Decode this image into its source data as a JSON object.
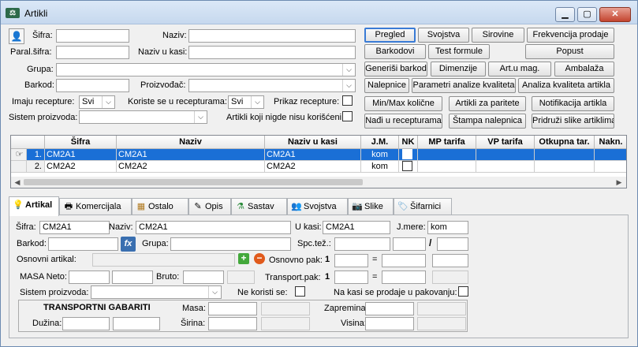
{
  "window": {
    "title": "Artikli",
    "app_icon": "scale-icon"
  },
  "filters": {
    "sifra_label": "Šifra:",
    "sifra_value": "",
    "naziv_label": "Naziv:",
    "naziv_value": "",
    "paral_sifra_label": "Paral.šifra:",
    "paral_sifra_value": "",
    "naziv_u_kasi_label": "Naziv u kasi:",
    "naziv_u_kasi_value": "",
    "grupa_label": "Grupa:",
    "grupa_value": "",
    "barkod_label": "Barkod:",
    "barkod_value": "",
    "proizvodjac_label": "Proizvođač:",
    "proizvodjac_value": "",
    "imaju_recepture_label": "Imaju recepture:",
    "imaju_recepture_value": "Svi",
    "koriste_se_label": "Koriste se u recepturama:",
    "koriste_se_value": "Svi",
    "prikaz_recepture_label": "Prikaz recepture:",
    "sistem_proizvoda_label": "Sistem proizvoda:",
    "sistem_proizvoda_value": "",
    "nigde_nisu_label": "Artikli koji nigde nisu korišćeni:"
  },
  "actions": {
    "pregled": "Pregled",
    "svojstva": "Svojstva",
    "sirovine": "Sirovine",
    "frekvencija": "Frekvencija prodaje",
    "barkodovi": "Barkodovi",
    "test_formule": "Test formule",
    "popust": "Popust",
    "generisi_barkod": "Generiši barkod",
    "dimenzije": "Dimenzije",
    "art_u_mag": "Art.u mag.",
    "ambalaza": "Ambalaža",
    "nalepnice": "Nalepnice",
    "parametri_analize": "Parametri analize kvaliteta",
    "analiza_kvaliteta": "Analiza kvaliteta artikla",
    "min_max": "Min/Max količne",
    "artikli_za_paritete": "Artikli za paritete",
    "notifikacija": "Notifikacija artikla",
    "nadji_u_recepturama": "Nađi u recepturama",
    "stampa_nalepnica": "Štampa nalepnica",
    "pridruzi_slike": "Pridruži slike artiklima"
  },
  "grid": {
    "columns": [
      "Šifra",
      "Naziv",
      "Naziv u kasi",
      "J.M.",
      "NK",
      "MP tarifa",
      "VP tarifa",
      "Otkupna tar.",
      "Nakn."
    ],
    "rows": [
      {
        "num": "1.",
        "sifra": "CM2A1",
        "naziv": "CM2A1",
        "naziv_u_kasi": "CM2A1",
        "jm": "kom"
      },
      {
        "num": "2.",
        "sifra": "CM2A2",
        "naziv": "CM2A2",
        "naziv_u_kasi": "CM2A2",
        "jm": "kom"
      }
    ]
  },
  "tabs": [
    {
      "label": "Artikal",
      "icon": "lightbulb-icon"
    },
    {
      "label": "Komercijala",
      "icon": "cash-register-icon"
    },
    {
      "label": "Ostalo",
      "icon": "boxes-icon"
    },
    {
      "label": "Opis",
      "icon": "notepad-icon"
    },
    {
      "label": "Sastav",
      "icon": "flask-icon"
    },
    {
      "label": "Svojstva",
      "icon": "people-icon"
    },
    {
      "label": "Slike",
      "icon": "camera-icon"
    },
    {
      "label": "Šifarnici",
      "icon": "tag-icon"
    }
  ],
  "detail": {
    "sifra_label": "Šifra:",
    "sifra_value": "CM2A1",
    "naziv_label": "Naziv:",
    "naziv_value": "CM2A1",
    "u_kasi_label": "U kasi:",
    "u_kasi_value": "CM2A1",
    "jmere_label": "J.mere:",
    "jmere_value": "kom",
    "barkod_label": "Barkod:",
    "barkod_value": "",
    "grupa_label": "Grupa:",
    "grupa_value": "",
    "spc_tez_label": "Spc.tež.:",
    "slash": "/",
    "osnovni_artikal_label": "Osnovni artikal:",
    "osnovno_pak_label": "Osnovno pak:",
    "osnovno_pak_value": "1",
    "eq1": "=",
    "masa_neto_label": "MASA Neto:",
    "bruto_label": "Bruto:",
    "transport_pak_label": "Transport.pak:",
    "transport_pak_value": "1",
    "eq2": "=",
    "sistem_proizvoda_label": "Sistem proizvoda:",
    "sistem_proizvoda_value": "",
    "ne_koristi_se_label": "Ne koristi se:",
    "na_kasi_label": "Na kasi se prodaje u pakovanju:",
    "transportni_gabariti": "TRANSPORTNI GABARITI",
    "masa_label": "Masa:",
    "zapremina_label": "Zapremina:",
    "duzina_label": "Dužina:",
    "sirina_label": "Širina:",
    "visina_label": "Visina:"
  },
  "colors": {
    "selection": "#1a6fd6",
    "accent": "#3a7bd5",
    "add_green": "#43a83b",
    "remove_red": "#e05a1c"
  }
}
